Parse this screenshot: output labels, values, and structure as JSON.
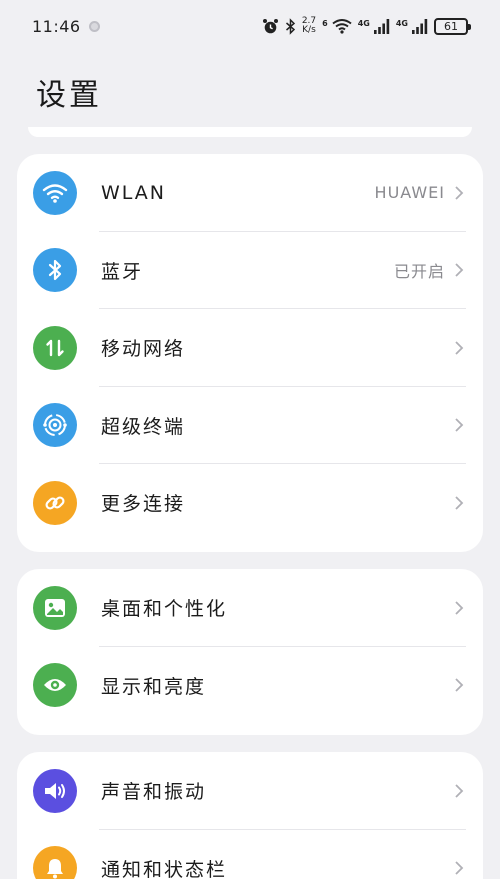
{
  "status_bar": {
    "time": "11:46",
    "speed_top": "2.7",
    "speed_unit": "K/s",
    "wifi_badge": "6",
    "net1": "4G",
    "net2": "4G",
    "battery": "61"
  },
  "page": {
    "title": "设置"
  },
  "groups": [
    {
      "items": [
        {
          "label": "WLAN",
          "value": "HUAWEI",
          "icon": "wifi-icon",
          "color": "#3a9ee6"
        },
        {
          "label": "蓝牙",
          "value": "已开启",
          "icon": "bluetooth-icon",
          "color": "#3a9ee6"
        },
        {
          "label": "移动网络",
          "value": "",
          "icon": "mobile-data-icon",
          "color": "#4caf50"
        },
        {
          "label": "超级终端",
          "value": "",
          "icon": "super-device-icon",
          "color": "#3a9ee6"
        },
        {
          "label": "更多连接",
          "value": "",
          "icon": "link-icon",
          "color": "#f5a623"
        }
      ]
    },
    {
      "items": [
        {
          "label": "桌面和个性化",
          "value": "",
          "icon": "wallpaper-icon",
          "color": "#4caf50"
        },
        {
          "label": "显示和亮度",
          "value": "",
          "icon": "eye-icon",
          "color": "#4caf50"
        }
      ]
    },
    {
      "items": [
        {
          "label": "声音和振动",
          "value": "",
          "icon": "speaker-icon",
          "color": "#5b4fe0"
        },
        {
          "label": "通知和状态栏",
          "value": "",
          "icon": "bell-icon",
          "color": "#f5a623"
        }
      ]
    }
  ]
}
